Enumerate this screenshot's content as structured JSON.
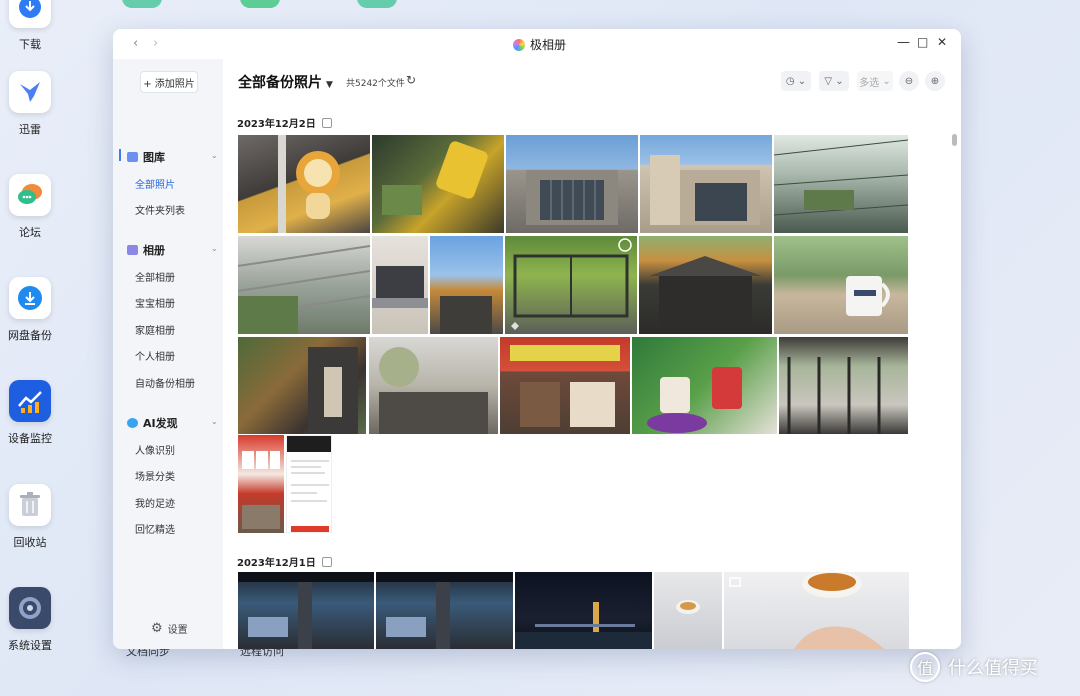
{
  "desktop": {
    "dock": [
      {
        "label": "下载",
        "icon": "download-app-icon",
        "color": "#2f7bf3"
      },
      {
        "label": "迅雷",
        "icon": "thunder-bird-icon",
        "color": "#4c7ff0"
      },
      {
        "label": "论坛",
        "icon": "forum-chat-icon",
        "color": "#2fbf8c"
      },
      {
        "label": "网盘备份",
        "icon": "cloud-backup-icon",
        "color": "#1f8bf0"
      },
      {
        "label": "设备监控",
        "icon": "device-monitor-icon",
        "color": "#1d5fe0"
      },
      {
        "label": "回收站",
        "icon": "recycle-bin-icon",
        "color": "#cfd4dc"
      },
      {
        "label": "系统设置",
        "icon": "system-settings-icon",
        "color": "#3b4a6b"
      }
    ],
    "bottom_labels": [
      "文档同步",
      "远程访问"
    ],
    "watermark": "什么值得买"
  },
  "window": {
    "title": "极相册",
    "nav": {
      "back": "‹",
      "forward": "›"
    },
    "controls": {
      "minimize": "—",
      "maximize": "□",
      "close": "✕"
    }
  },
  "sidebar": {
    "add_button": "+ 添加照片",
    "sections": [
      {
        "title": "图库",
        "icon_color": "#6c8ff2",
        "items": [
          "全部照片",
          "文件夹列表"
        ]
      },
      {
        "title": "相册",
        "icon_color": "#8a87e6",
        "items": [
          "全部相册",
          "宝宝相册",
          "家庭相册",
          "个人相册",
          "自动备份相册"
        ]
      },
      {
        "title": "AI发现",
        "icon_color": "#3aa3ef",
        "items": [
          "人像识别",
          "场景分类",
          "我的足迹",
          "回忆精选"
        ]
      }
    ],
    "active_item": "全部照片",
    "settings_label": "设置"
  },
  "main": {
    "title": "全部备份照片",
    "count": "共5242个文件",
    "toolbar": {
      "sort_icon": "sort-time-icon",
      "filter_icon": "filter-icon",
      "select_label": "多选",
      "zoom_out_icon": "zoom-out-icon",
      "zoom_in_icon": "zoom-in-icon"
    },
    "groups": [
      {
        "date": "2023年12月2日"
      },
      {
        "date": "2023年12月1日"
      }
    ]
  }
}
